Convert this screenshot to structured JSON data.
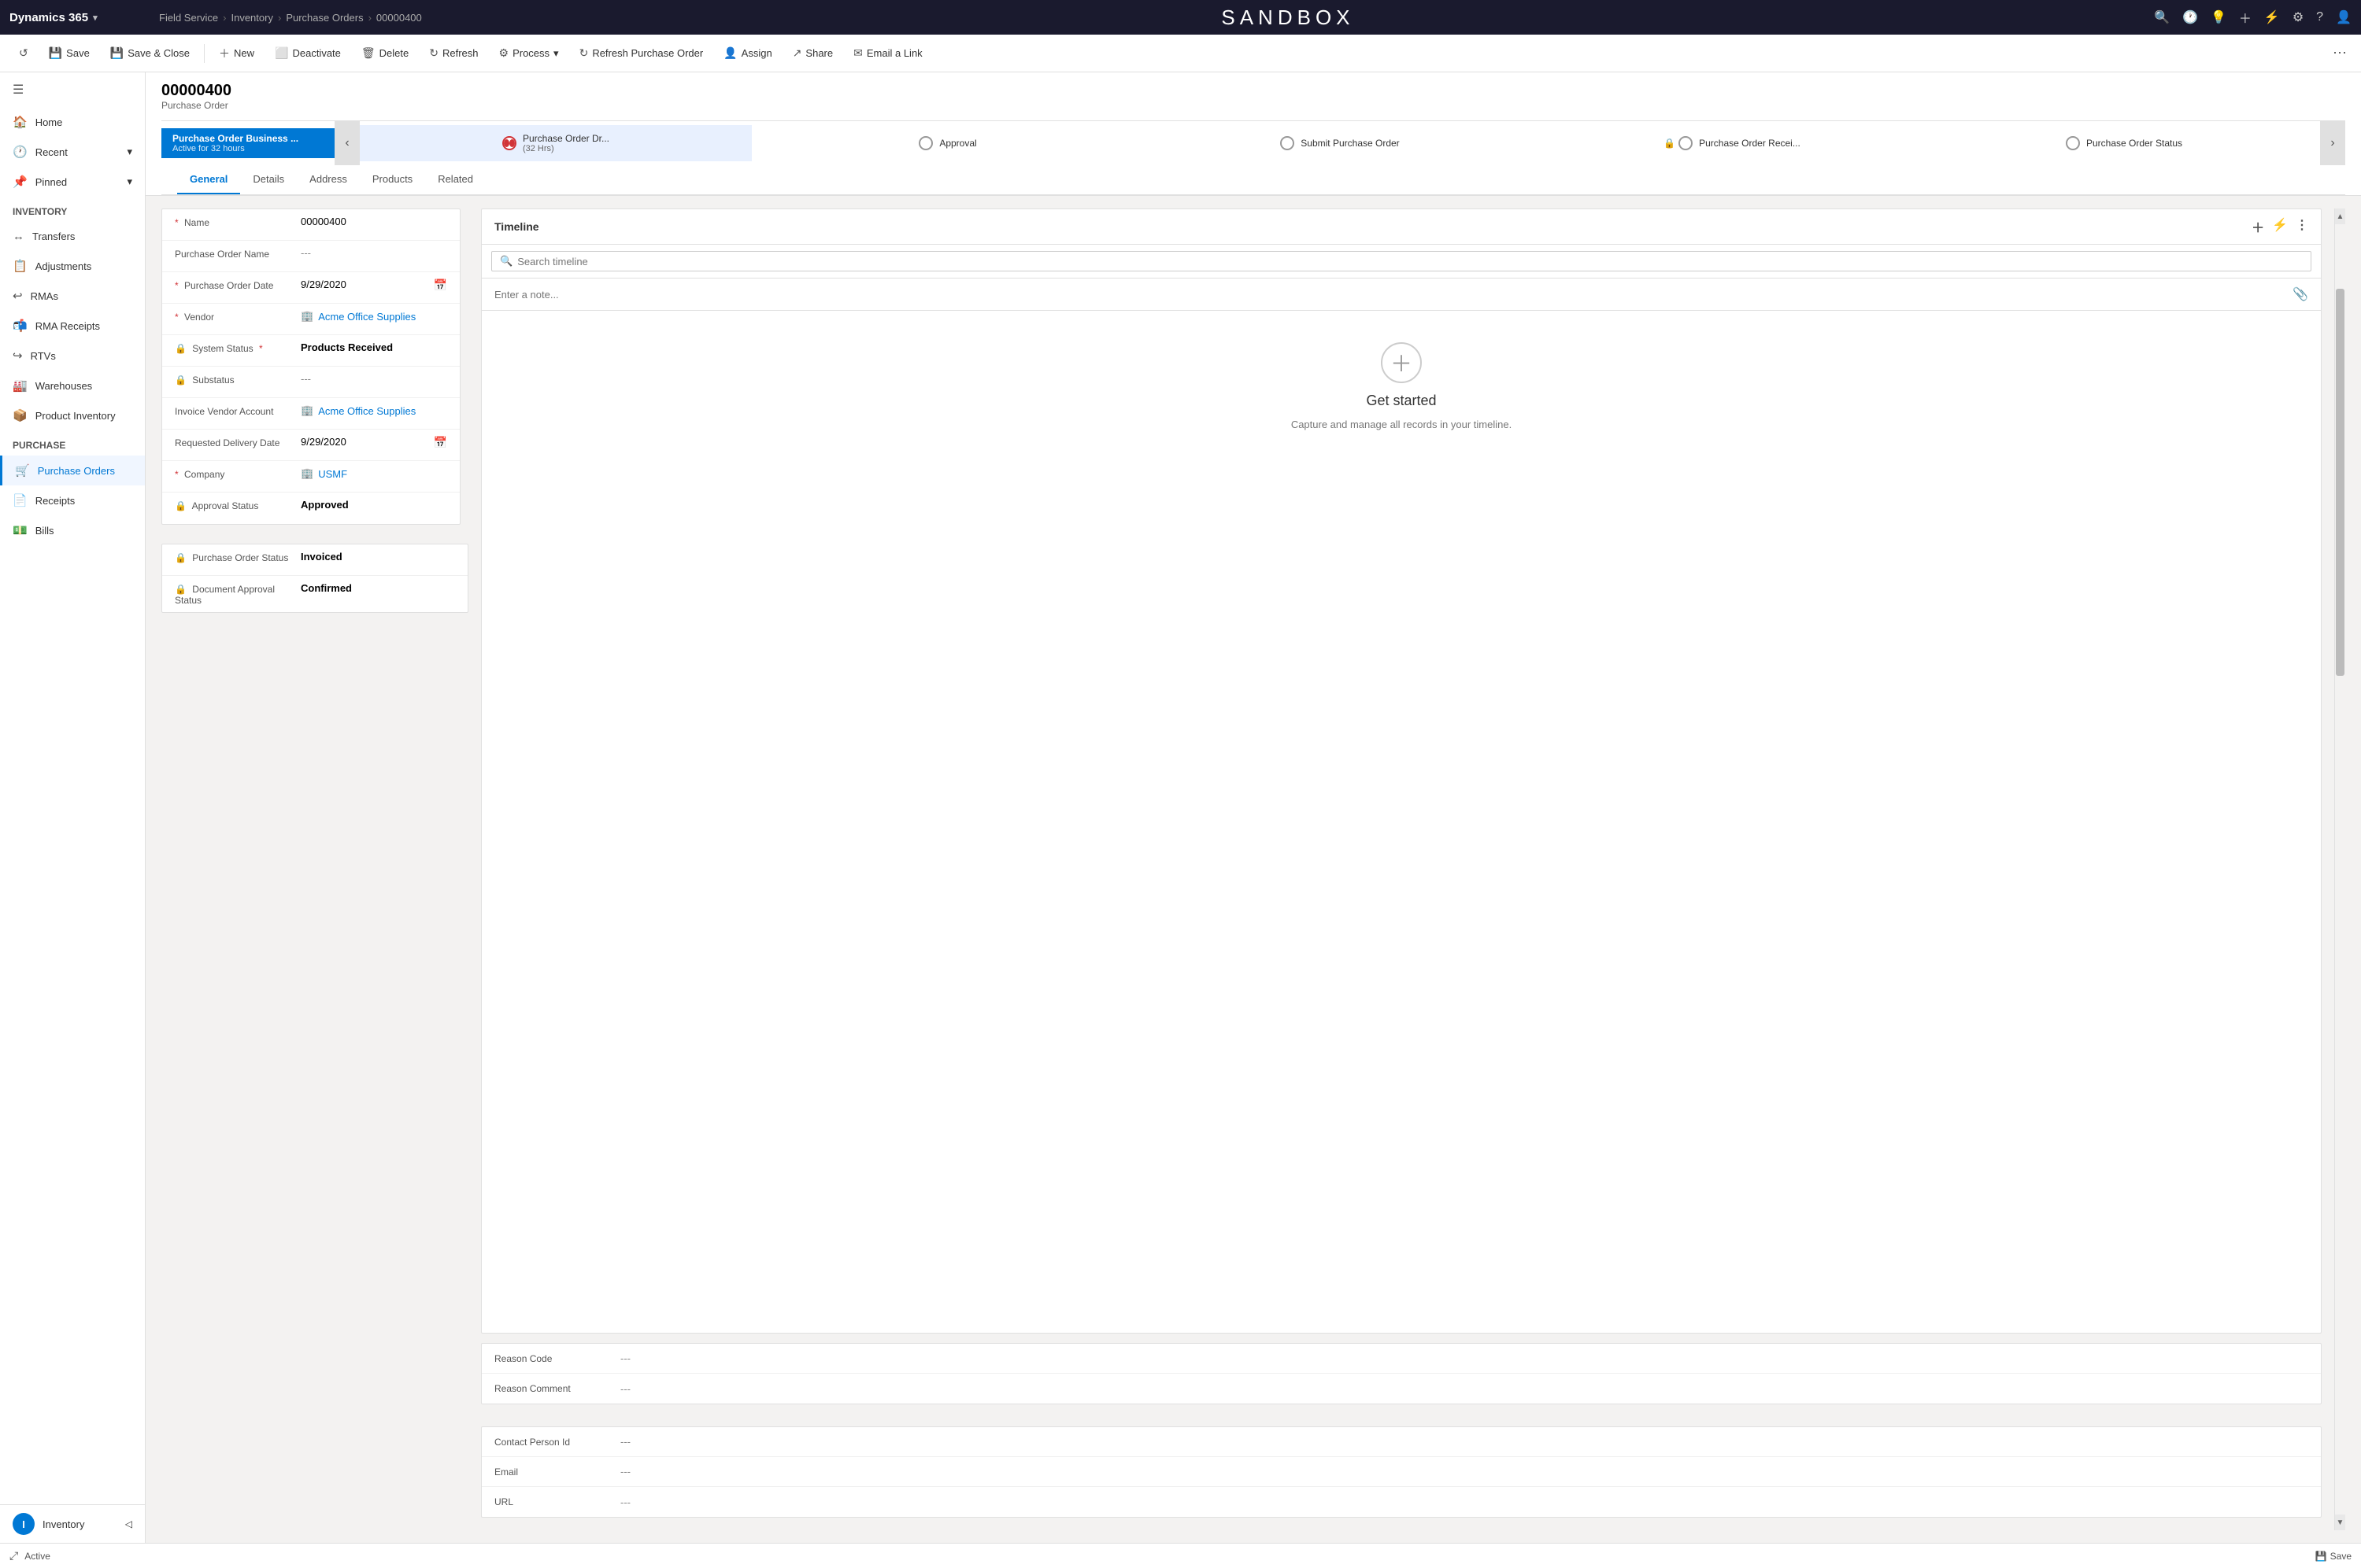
{
  "topbar": {
    "brand": "Dynamics 365",
    "chevron": "▾",
    "module": "Field Service",
    "breadcrumb": [
      "Inventory",
      "Purchase Orders",
      "00000400"
    ],
    "sandbox_label": "SANDBOX",
    "icons": [
      "🔍",
      "🕐",
      "💡",
      "+",
      "⚡",
      "⚙",
      "?",
      "👤"
    ]
  },
  "commandbar": {
    "save_label": "Save",
    "save_close_label": "Save & Close",
    "new_label": "New",
    "deactivate_label": "Deactivate",
    "delete_label": "Delete",
    "refresh_label": "Refresh",
    "process_label": "Process",
    "refresh_po_label": "Refresh Purchase Order",
    "assign_label": "Assign",
    "share_label": "Share",
    "email_link_label": "Email a Link"
  },
  "record": {
    "id": "00000400",
    "type": "Purchase Order"
  },
  "process_stages": [
    {
      "label": "Purchase Order Dr...",
      "sublabel": "(32 Hrs)",
      "current": true
    },
    {
      "label": "Approval",
      "sublabel": "",
      "current": false
    },
    {
      "label": "Submit Purchase Order",
      "sublabel": "",
      "current": false
    },
    {
      "label": "Purchase Order Recei...",
      "sublabel": "",
      "current": false,
      "locked": true
    },
    {
      "label": "Purchase Order Status",
      "sublabel": "",
      "current": false
    }
  ],
  "active_process": {
    "title": "Purchase Order Business ...",
    "subtitle": "Active for 32 hours"
  },
  "tabs": [
    "General",
    "Details",
    "Address",
    "Products",
    "Related"
  ],
  "active_tab": "General",
  "form_fields": [
    {
      "label": "Name",
      "required": true,
      "value": "00000400",
      "type": "text"
    },
    {
      "label": "Purchase Order Name",
      "required": false,
      "value": "---",
      "type": "text"
    },
    {
      "label": "Purchase Order Date",
      "required": true,
      "value": "9/29/2020",
      "type": "date"
    },
    {
      "label": "Vendor",
      "required": true,
      "value": "Acme Office Supplies",
      "type": "link"
    },
    {
      "label": "System Status",
      "required": true,
      "value": "Products Received",
      "type": "bold"
    },
    {
      "label": "Substatus",
      "required": false,
      "value": "---",
      "type": "text"
    },
    {
      "label": "Invoice Vendor Account",
      "required": false,
      "value": "Acme Office Supplies",
      "type": "link"
    },
    {
      "label": "Requested Delivery Date",
      "required": false,
      "value": "9/29/2020",
      "type": "date"
    },
    {
      "label": "Company",
      "required": true,
      "value": "USMF",
      "type": "link-company"
    },
    {
      "label": "Approval Status",
      "required": false,
      "value": "Approved",
      "type": "bold"
    }
  ],
  "bottom_fields": [
    {
      "label": "Purchase Order Status",
      "value": "Invoiced",
      "locked": true,
      "type": "bold"
    },
    {
      "label": "Document Approval Status",
      "value": "Confirmed",
      "locked": true,
      "type": "bold"
    }
  ],
  "timeline": {
    "title": "Timeline",
    "search_placeholder": "Search timeline",
    "note_placeholder": "Enter a note...",
    "empty_title": "Get started",
    "empty_subtitle": "Capture and manage all records in your timeline."
  },
  "reason_section": [
    {
      "label": "Reason Code",
      "value": "---"
    },
    {
      "label": "Reason Comment",
      "value": "---"
    }
  ],
  "contact_section": [
    {
      "label": "Contact Person Id",
      "value": "---"
    },
    {
      "label": "Email",
      "value": "---"
    },
    {
      "label": "URL",
      "value": "---"
    }
  ],
  "sidebar": {
    "nav_top": [
      {
        "label": "Home",
        "icon": "🏠"
      },
      {
        "label": "Recent",
        "icon": "🕐",
        "hasArrow": true
      },
      {
        "label": "Pinned",
        "icon": "📌",
        "hasArrow": true
      }
    ],
    "section_inventory": "Inventory",
    "nav_inventory": [
      {
        "label": "Transfers",
        "icon": "↔"
      },
      {
        "label": "Adjustments",
        "icon": "📋"
      },
      {
        "label": "RMAs",
        "icon": "↩"
      },
      {
        "label": "RMA Receipts",
        "icon": "📬"
      },
      {
        "label": "RTVs",
        "icon": "↪"
      },
      {
        "label": "Warehouses",
        "icon": "🏭"
      },
      {
        "label": "Product Inventory",
        "icon": "📦"
      }
    ],
    "section_purchase": "Purchase",
    "nav_purchase": [
      {
        "label": "Purchase Orders",
        "icon": "🛒",
        "active": true
      },
      {
        "label": "Receipts",
        "icon": "📄"
      },
      {
        "label": "Bills",
        "icon": "💵"
      }
    ],
    "footer_label": "Inventory",
    "footer_avatar": "I"
  },
  "statusbar": {
    "status": "Active",
    "save_label": "Save"
  }
}
